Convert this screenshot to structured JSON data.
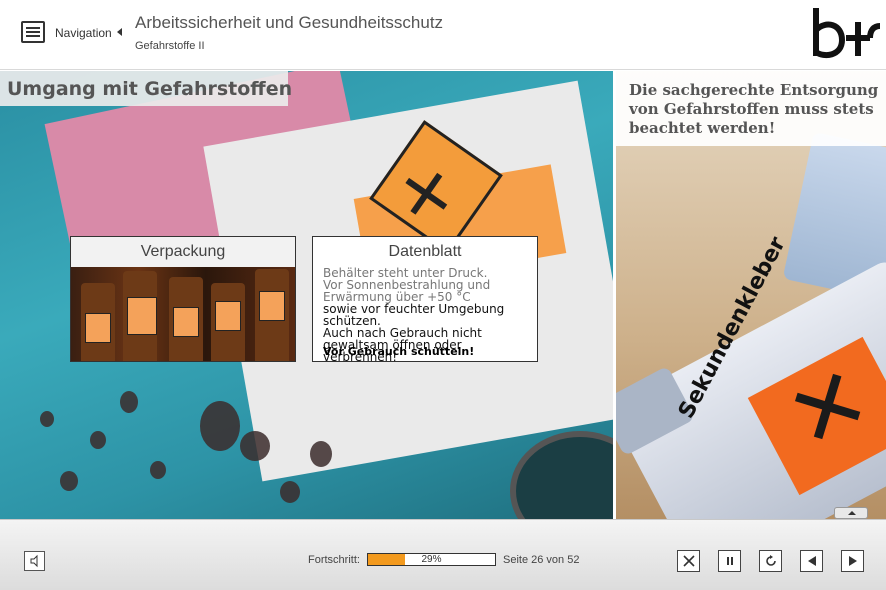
{
  "header": {
    "nav_label": "Navigation",
    "course_title": "Arbeitssicherheit und Gesundheitsschutz",
    "course_subtitle": "Gefahrstoffe II"
  },
  "slide": {
    "title": "Umgang mit Gefahrstoffen",
    "hint": "Die sachgerechte Entsorgung von Gefahrstoffen muss stets beachtet werden!",
    "cards": [
      {
        "label": "Verpackung"
      },
      {
        "label": "Datenblatt",
        "lines": [
          "Behälter steht unter Druck.",
          "Vor Sonnenbestrahlung und",
          "Erwärmung über +50 °C",
          "sowie vor feuchter Umgebung",
          "schützen.",
          "Auch nach Gebrauch nicht",
          "gewaltsam öffnen oder",
          "verbrennen!"
        ],
        "bold_line": "Vor Gebrauch schütteln!"
      }
    ],
    "tube_text": "Sekundenkleber"
  },
  "footer": {
    "progress_label": "Fortschritt:",
    "progress_percent": 29,
    "progress_text": "29%",
    "page_text": "Seite 26 von 52"
  },
  "colors": {
    "progress_fill": "#f39a1e",
    "accent": "#f26a1f"
  }
}
